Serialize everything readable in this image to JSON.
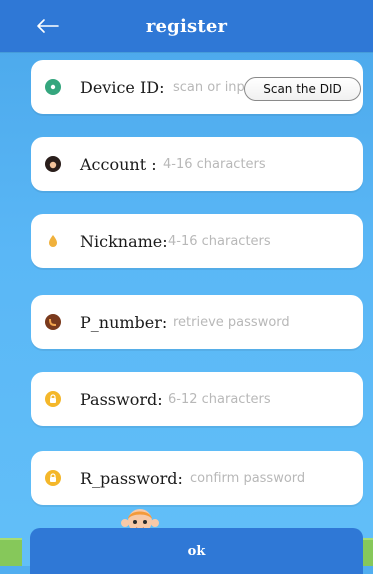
{
  "header": {
    "title": "register",
    "back_icon": "back-arrow-icon",
    "color": "#2F78D6"
  },
  "form": {
    "device_id": {
      "label": "Device ID:",
      "placeholder": "scan or input",
      "icon": "location-pin-icon",
      "icon_color": "#35A67E"
    },
    "scan_button_label": "Scan the DID",
    "account": {
      "label": "Account :",
      "placeholder": "4-16 characters",
      "icon": "person-avatar-icon",
      "icon_color": "#2A1E1B"
    },
    "nickname": {
      "label": "Nickname:",
      "placeholder": "4-16 characters",
      "icon": "drop-icon",
      "icon_color": "#F0B13C"
    },
    "p_number": {
      "label": "P_number:",
      "placeholder": "retrieve password",
      "icon": "phone-icon",
      "icon_color": "#7A3A1D"
    },
    "password": {
      "label": "Password:",
      "placeholder": "6-12 characters",
      "icon": "lock-icon",
      "icon_color": "#F4B72A"
    },
    "r_password": {
      "label": "R_password:",
      "placeholder": "confirm password",
      "icon": "lock-icon",
      "icon_color": "#F4B72A"
    }
  },
  "footer": {
    "ok_label": "ok"
  },
  "colors": {
    "background": "#51AEF0",
    "card": "#FFFFFF",
    "placeholder": "#B8B8B8"
  }
}
